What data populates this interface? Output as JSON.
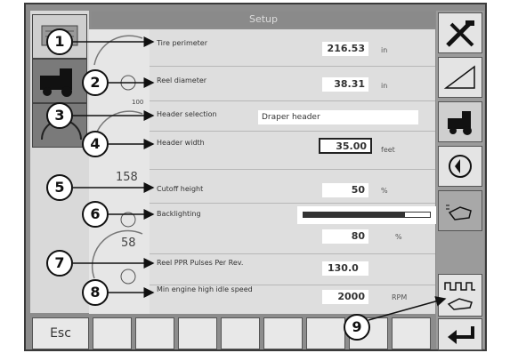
{
  "title": "Setup",
  "rows": [
    {
      "label": "Tire perimeter",
      "value": "216.53",
      "unit": "in"
    },
    {
      "label": "Reel diameter",
      "value": "38.31",
      "unit": "in"
    },
    {
      "label": "Header selection",
      "value": "Draper header",
      "unit": ""
    },
    {
      "label": "Header width",
      "value": "35.00",
      "unit": "feet"
    },
    {
      "label": "Cutoff height",
      "value": "50",
      "unit": "%"
    },
    {
      "label": "Backlighting",
      "value": "80",
      "unit": "%"
    },
    {
      "label": "Reel PPR  Pulses Per Rev.",
      "value": "130.0",
      "unit": ""
    },
    {
      "label": "Min engine high idle speed",
      "value": "2000",
      "unit": "RPM"
    }
  ],
  "backlighting_level": 0.8,
  "gauge_numbers": {
    "top": "158",
    "bottom": "58",
    "tiny": "100"
  },
  "esc_label": "Esc",
  "callouts": [
    "1",
    "2",
    "3",
    "4",
    "5",
    "6",
    "7",
    "8",
    "9"
  ],
  "icons": {
    "right": [
      "tools-icon",
      "incline-icon",
      "combine-icon",
      "engine-icon",
      "touch-settings-icon",
      "reel-pulse-icon",
      "return-icon"
    ],
    "left": [
      "display-icon",
      "combine-icon",
      "gauge-icon"
    ]
  }
}
